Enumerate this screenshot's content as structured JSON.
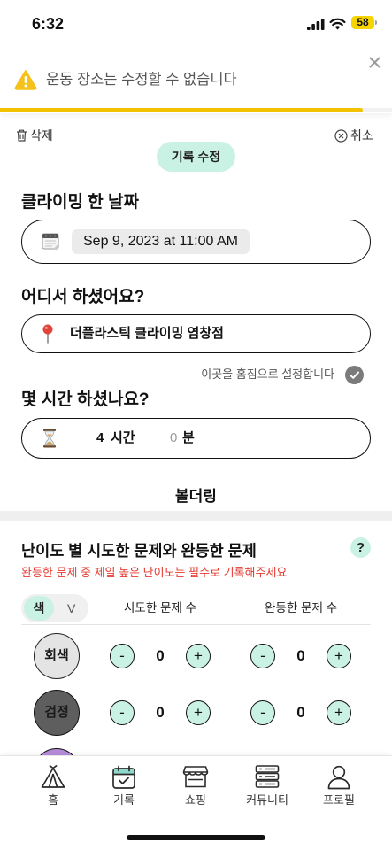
{
  "status_bar": {
    "time": "6:32",
    "battery": "58"
  },
  "toast": {
    "icon": "warning-icon",
    "message": "운동 장소는 수정할 수 없습니다",
    "progress": 0.925
  },
  "actions": {
    "delete_label": "삭제",
    "cancel_label": "취소"
  },
  "mode_badge": "기록 수정",
  "date_section": {
    "title": "클라이밍 한 날짜",
    "icon": "calendar-icon",
    "value": "Sep 9, 2023 at 11:00 AM"
  },
  "location_section": {
    "title": "어디서 하셨어요?",
    "icon": "pin-icon",
    "value": "더플라스틱 클라이밍 염창점",
    "home_gym_label": "이곳을 홈짐으로 설정합니다",
    "home_gym_checked": false
  },
  "duration_section": {
    "title": "몇 시간 하셨나요?",
    "icon": "hourglass-icon",
    "hours": "4",
    "hours_unit": "시간",
    "minutes": "0",
    "minutes_unit": "분"
  },
  "category": "볼더링",
  "difficulty": {
    "title": "난이도 별 시도한 문제와 완등한 문제",
    "help_label": "?",
    "note": "완등한 문제 중 제일 높은 난이도는 필수로 기록해주세요",
    "toggle": {
      "active": "색",
      "inactive": "V"
    },
    "columns": {
      "attempted": "시도한 문제 수",
      "completed": "완등한 문제 수"
    },
    "minus_label": "-",
    "plus_label": "+",
    "rows": [
      {
        "label": "회색",
        "color": "#e4e4e4",
        "attempted": "0",
        "completed": "0"
      },
      {
        "label": "검정",
        "color": "#5e5e5e",
        "attempted": "0",
        "completed": "0"
      },
      {
        "color": "#b58bd9"
      }
    ]
  },
  "tab_bar": {
    "active_index": 1,
    "items": [
      {
        "label": "홈",
        "icon": "tent-icon"
      },
      {
        "label": "기록",
        "icon": "calendar-check-icon"
      },
      {
        "label": "쇼핑",
        "icon": "shop-icon"
      },
      {
        "label": "커뮤니티",
        "icon": "community-list-icon"
      },
      {
        "label": "프로필",
        "icon": "profile-icon"
      }
    ]
  },
  "colors": {
    "accent_mint": "#c9f1e4",
    "warning_yellow": "#f2c200",
    "note_red": "#e5392f",
    "tab_active": "#8fd8cb"
  }
}
